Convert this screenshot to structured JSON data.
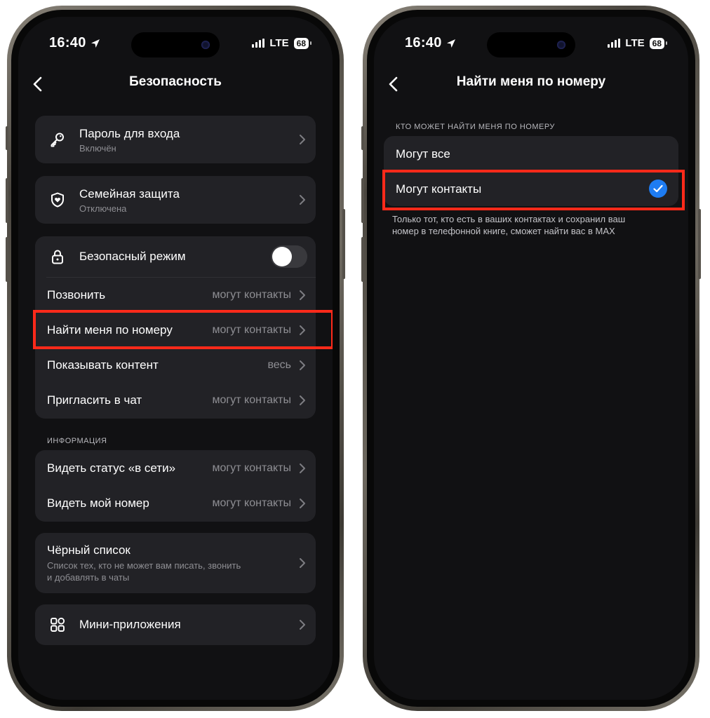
{
  "status_bar": {
    "time": "16:40",
    "network": "LTE",
    "battery": "68",
    "location_icon": "location-arrow-icon",
    "signal_icon": "signal-icon"
  },
  "left_screen": {
    "title": "Безопасность",
    "back_icon": "chevron-left-icon",
    "login_password": {
      "title": "Пароль для входа",
      "subtitle": "Включён",
      "icon": "key-icon"
    },
    "family_protection": {
      "title": "Семейная защита",
      "subtitle": "Отключена",
      "icon": "shield-heart-icon"
    },
    "safe_mode": {
      "title": "Безопасный режим",
      "icon": "lock-icon",
      "enabled": false
    },
    "privacy_items": [
      {
        "label": "Позвонить",
        "value": "могут контакты"
      },
      {
        "label": "Найти меня по номеру",
        "value": "могут контакты"
      },
      {
        "label": "Показывать контент",
        "value": "весь"
      },
      {
        "label": "Пригласить в чат",
        "value": "могут контакты"
      }
    ],
    "info_header": "ИНФОРМАЦИЯ",
    "info_items": [
      {
        "label": "Видеть статус «в сети»",
        "value": "могут контакты"
      },
      {
        "label": "Видеть мой номер",
        "value": "могут контакты"
      }
    ],
    "blacklist": {
      "title": "Чёрный список",
      "subtitle_line1": "Список тех, кто не может вам писать, звонить",
      "subtitle_line2": "и добавлять в чаты"
    },
    "mini_apps": {
      "title": "Мини-приложения",
      "icon": "grid-apps-icon"
    }
  },
  "right_screen": {
    "title": "Найти меня по номеру",
    "back_icon": "chevron-left-icon",
    "section_header": "КТО МОЖЕТ НАЙТИ МЕНЯ ПО НОМЕРУ",
    "options": [
      {
        "label": "Могут все",
        "selected": false
      },
      {
        "label": "Могут контакты",
        "selected": true
      }
    ],
    "footnote_line1": "Только тот, кто есть в ваших контактах и сохранил ваш",
    "footnote_line2": "номер в телефонной книге, сможет найти вас в MAX",
    "check_icon": "checkmark-circle-icon"
  },
  "colors": {
    "background": "#111113",
    "card": "#222226",
    "highlight": "#ff2a1a",
    "accent": "#1e7cf2",
    "secondary_text": "#8e8e93"
  }
}
